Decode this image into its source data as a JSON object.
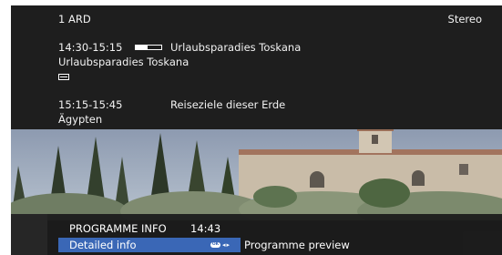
{
  "channel": {
    "number_name": "1  ARD",
    "audio": "Stereo"
  },
  "current_programme": {
    "time": "14:30-15:15",
    "progress": 0.45,
    "title": "Urlaubsparadies Toskana",
    "subtitle": "Urlaubsparadies Toskana"
  },
  "next_programme": {
    "time": "15:15-15:45",
    "title": "Reiseziele dieser Erde",
    "subtitle": "Ägypten"
  },
  "menu": {
    "title": "PROGRAMME INFO",
    "time": "14:43",
    "active_tab": "Detailed info",
    "next_tab": "Programme preview",
    "ok_icon_text": "OK"
  },
  "colors": {
    "highlight": "#3a67b6",
    "panel": "#1e1e1e",
    "sky": "#9aa7b8"
  },
  "icons": [
    "format-icon",
    "ok-button-icon",
    "left-right-arrows-icon"
  ]
}
